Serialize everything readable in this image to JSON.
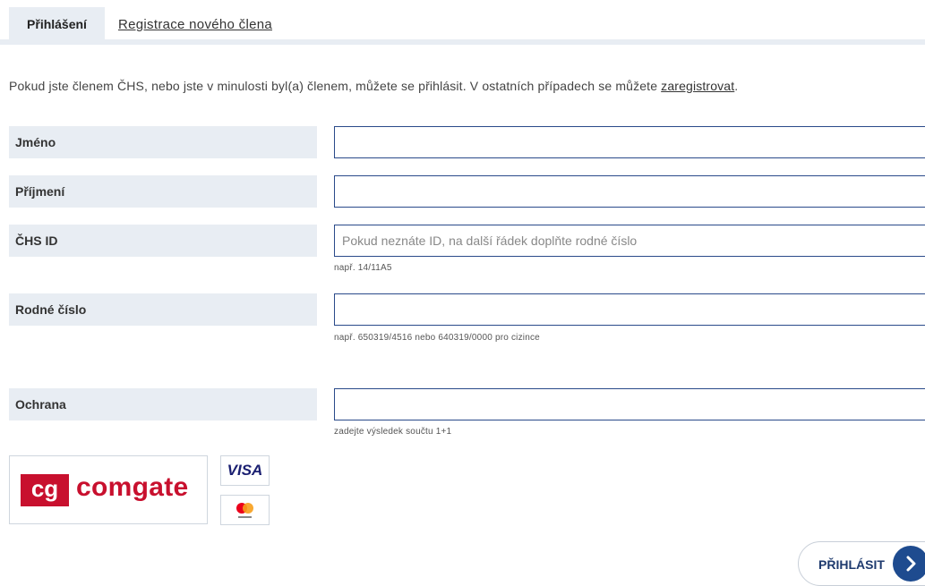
{
  "tabs": {
    "login": "Přihlášení",
    "register": "Registrace nového člena"
  },
  "intro": {
    "text": "Pokud jste členem ČHS, nebo jste v minulosti byl(a) členem, můžete se přihlásit. V ostatních případech se můžete ",
    "link": "zaregistrovat",
    "end": "."
  },
  "form": {
    "first_name": {
      "label": "Jméno",
      "value": ""
    },
    "last_name": {
      "label": "Příjmení",
      "value": ""
    },
    "chs_id": {
      "label": "ČHS ID",
      "value": "",
      "placeholder": "Pokud neznáte ID, na další řádek doplňte rodné číslo",
      "hint": "např. 14/11A5"
    },
    "birth_number": {
      "label": "Rodné číslo",
      "value": "",
      "hint": "např. 650319/4516 nebo 640319/0000 pro cizince"
    },
    "protection": {
      "label": "Ochrana",
      "value": "",
      "hint": "zadejte výsledek součtu 1+1"
    }
  },
  "payment": {
    "comgate_badge": "cg",
    "comgate_name": "comgate",
    "visa": "VISA",
    "mastercard_icon": "mastercard-icon",
    "colors": {
      "comgate": "#c8102e",
      "visa": "#1a1f71",
      "mc_red": "#eb001b",
      "mc_yellow": "#f79e1b"
    }
  },
  "submit": {
    "label": "PŘIHLÁSIT",
    "icon": "chevron-right-icon",
    "color": "#1e4b8f"
  }
}
